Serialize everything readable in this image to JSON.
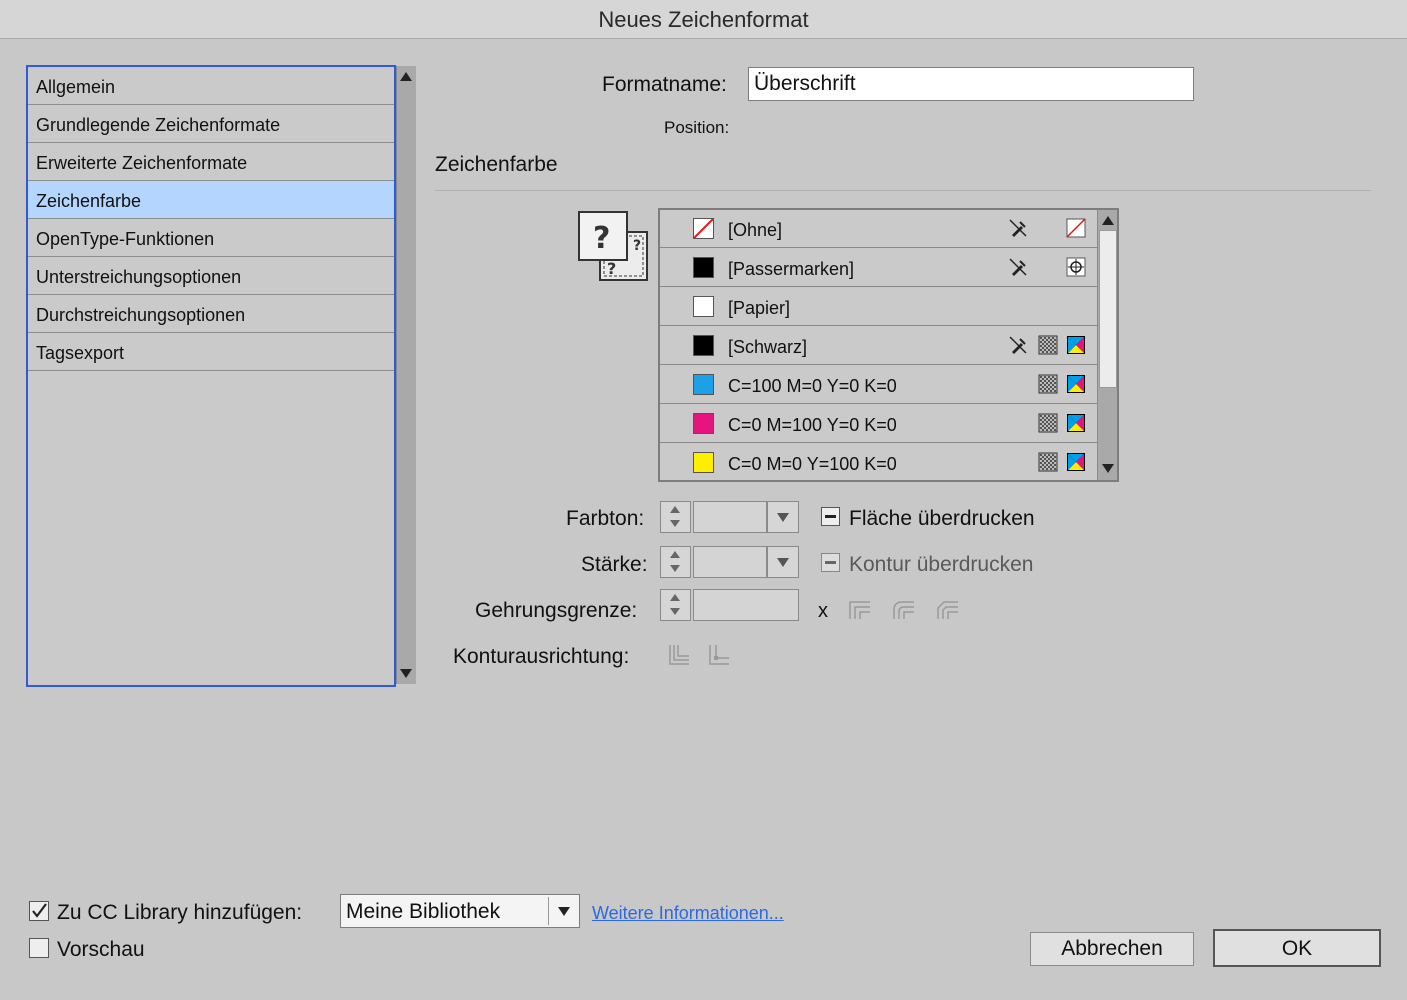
{
  "window": {
    "title": "Neues Zeichenformat"
  },
  "sidebar": {
    "items": [
      {
        "label": "Allgemein"
      },
      {
        "label": "Grundlegende Zeichenformate"
      },
      {
        "label": "Erweiterte Zeichenformate"
      },
      {
        "label": "Zeichenfarbe",
        "selected": true
      },
      {
        "label": "OpenType-Funktionen"
      },
      {
        "label": "Unterstreichungsoptionen"
      },
      {
        "label": "Durchstreichungsoptionen"
      },
      {
        "label": "Tagsexport"
      }
    ]
  },
  "form": {
    "formatname_label": "Formatname:",
    "formatname_value": "Überschrift",
    "position_label": "Position:",
    "section_title": "Zeichenfarbe"
  },
  "swatches": [
    {
      "name": "[Ohne]",
      "color": "none",
      "icons": [
        "pen-slash-icon",
        "none-swatch-icon"
      ]
    },
    {
      "name": "[Passermarken]",
      "color": "#000000",
      "icons": [
        "pen-slash-icon",
        "registration-icon"
      ]
    },
    {
      "name": "[Papier]",
      "color": "#ffffff",
      "icons": []
    },
    {
      "name": "[Schwarz]",
      "color": "#000000",
      "icons": [
        "pen-slash-icon",
        "process-color-icon",
        "cmyk-icon"
      ]
    },
    {
      "name": "C=100 M=0 Y=0 K=0",
      "color": "#1ea0e6",
      "icons": [
        "process-color-icon",
        "cmyk-icon"
      ]
    },
    {
      "name": "C=0 M=100 Y=0 K=0",
      "color": "#e6147e",
      "icons": [
        "process-color-icon",
        "cmyk-icon"
      ]
    },
    {
      "name": "C=0 M=0 Y=100 K=0",
      "color": "#ffee00",
      "icons": [
        "process-color-icon",
        "cmyk-icon"
      ]
    }
  ],
  "controls": {
    "farbton_label": "Farbton:",
    "farbton_value": "",
    "staerke_label": "Stärke:",
    "staerke_value": "",
    "gehrung_label": "Gehrungsgrenze:",
    "gehrung_value": "",
    "gehrung_unit": "x",
    "kontur_label": "Konturausrichtung:",
    "flaeche_label": "Fläche überdrucken",
    "kontur_ueber_label": "Kontur überdrucken"
  },
  "footer": {
    "cc_label": "Zu CC Library hinzufügen:",
    "cc_checked": true,
    "library_value": "Meine Bibliothek",
    "info_link": "Weitere Informationen...",
    "preview_label": "Vorschau",
    "preview_checked": false,
    "cancel_label": "Abbrechen",
    "ok_label": "OK"
  },
  "colors": {
    "accent": "#2f5bd8",
    "selection": "#b4d5fe",
    "link": "#2d6ae0"
  }
}
